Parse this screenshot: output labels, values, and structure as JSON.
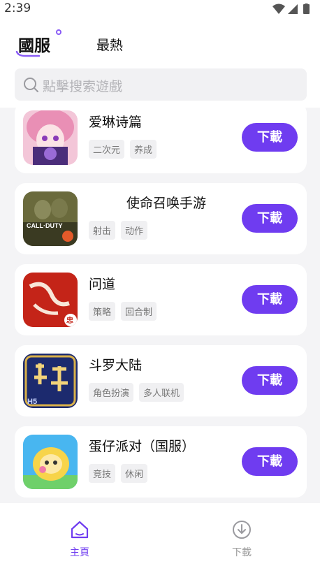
{
  "status_bar": {
    "time": "2:39"
  },
  "header": {
    "tabs": [
      {
        "label": "國服",
        "active": true
      },
      {
        "label": "最熱",
        "active": false
      }
    ]
  },
  "search": {
    "placeholder": "點擊搜索遊戲"
  },
  "games": [
    {
      "title": "爱琳诗篇",
      "tags": [
        "二次元",
        "养成"
      ],
      "button": "下載"
    },
    {
      "title": "使命召唤手游",
      "tags": [
        "射击",
        "动作"
      ],
      "button": "下載",
      "icon_text": "CALL·DUTY"
    },
    {
      "title": "问道",
      "tags": [
        "策略",
        "回合制"
      ],
      "button": "下載",
      "icon_badge": "忠"
    },
    {
      "title": "斗罗大陆",
      "tags": [
        "角色扮演",
        "多人联机"
      ],
      "button": "下載",
      "icon_text": "H5"
    },
    {
      "title": "蛋仔派对（国服）",
      "tags": [
        "竞技",
        "休闲"
      ],
      "button": "下載"
    }
  ],
  "bottom_nav": {
    "items": [
      {
        "label": "主頁",
        "icon": "home-icon",
        "active": true
      },
      {
        "label": "下載",
        "icon": "download-icon",
        "active": false
      }
    ]
  },
  "colors": {
    "accent": "#6f3cf0",
    "tab_accent": "#8a5cf6",
    "tag_bg": "#f0f0f2",
    "page_bg": "#f4f4f6"
  }
}
